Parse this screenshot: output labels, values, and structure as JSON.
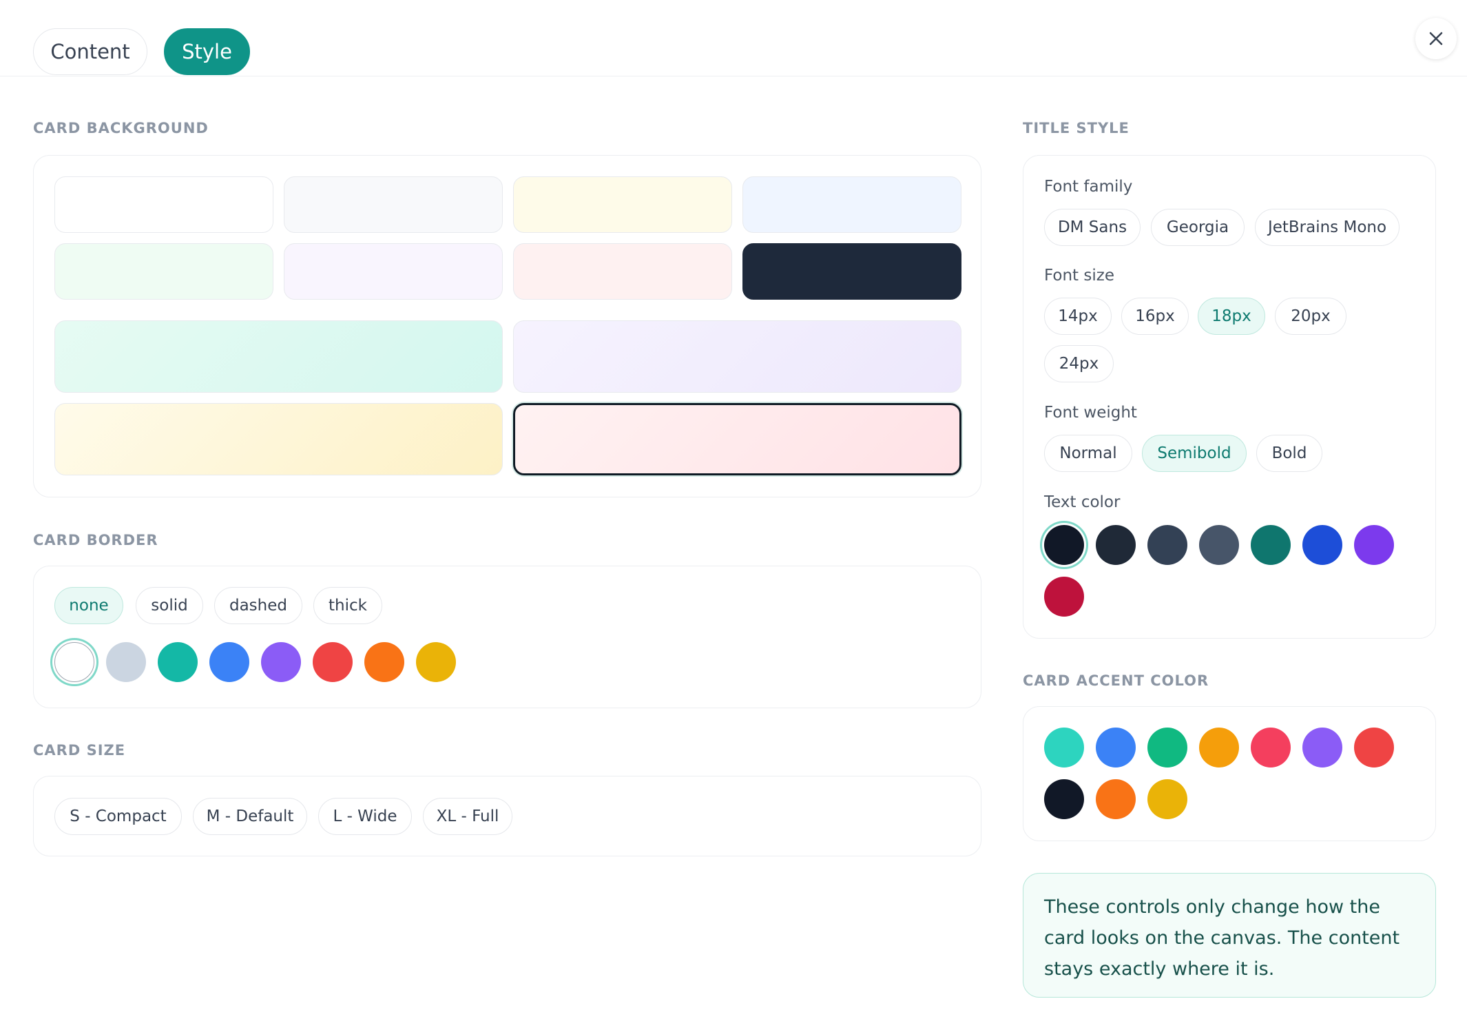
{
  "tabs": [
    {
      "label": "Content",
      "active": false
    },
    {
      "label": "Style",
      "active": true
    }
  ],
  "close_icon": "close-icon",
  "card_background": {
    "title": "CARD BACKGROUND",
    "solid_swatches": [
      "#ffffff",
      "#f8f9fb",
      "#fefbe9",
      "#eff5ff",
      "#effcf3",
      "#f9f5fe",
      "#fef1f1",
      "#1e293b"
    ],
    "gradient_swatches": [
      {
        "from": "#e6fbf3",
        "to": "#d4f7ef"
      },
      {
        "from": "#f6f3fe",
        "to": "#ede8fc"
      },
      {
        "from": "#fffbea",
        "to": "#fdf1c6"
      },
      {
        "from": "#fff2f2",
        "to": "#ffe2e6"
      }
    ],
    "selected_gradient": 3
  },
  "card_border": {
    "title": "CARD BORDER",
    "styles": [
      {
        "label": "none",
        "active": true
      },
      {
        "label": "solid",
        "active": false
      },
      {
        "label": "dashed",
        "active": false
      },
      {
        "label": "thick",
        "active": false
      }
    ],
    "colors": [
      "#ffffff",
      "#cbd5e1",
      "#14b8a6",
      "#3b82f6",
      "#8b5cf6",
      "#ef4444",
      "#f97316",
      "#eab308"
    ],
    "selected_color": 0
  },
  "card_size": {
    "title": "CARD SIZE",
    "options": [
      "S - Compact",
      "M - Default",
      "L - Wide",
      "XL - Full"
    ]
  },
  "title_style": {
    "title": "TITLE STYLE",
    "font_family_label": "Font family",
    "font_families": [
      {
        "label": "DM Sans",
        "active": false
      },
      {
        "label": "Georgia",
        "active": false
      },
      {
        "label": "JetBrains Mono",
        "active": false
      }
    ],
    "font_size_label": "Font size",
    "font_sizes": [
      {
        "label": "14px",
        "active": false
      },
      {
        "label": "16px",
        "active": false
      },
      {
        "label": "18px",
        "active": true
      },
      {
        "label": "20px",
        "active": false
      },
      {
        "label": "24px",
        "active": false
      }
    ],
    "font_weight_label": "Font weight",
    "font_weights": [
      {
        "label": "Normal",
        "active": false
      },
      {
        "label": "Semibold",
        "active": true
      },
      {
        "label": "Bold",
        "active": false
      }
    ],
    "text_color_label": "Text color",
    "text_colors": [
      "#111827",
      "#1f2937",
      "#334155",
      "#475569",
      "#0f766e",
      "#1d4ed8",
      "#7c3aed",
      "#be123c"
    ],
    "selected_text_color": 0
  },
  "card_accent": {
    "title": "CARD ACCENT COLOR",
    "colors": [
      "#2dd4bf",
      "#3b82f6",
      "#10b981",
      "#f59e0b",
      "#f43f5e",
      "#8b5cf6",
      "#ef4444",
      "#111827",
      "#f97316",
      "#eab308"
    ]
  },
  "note": "These controls only change how the card looks on the canvas. The content stays exactly where it is."
}
